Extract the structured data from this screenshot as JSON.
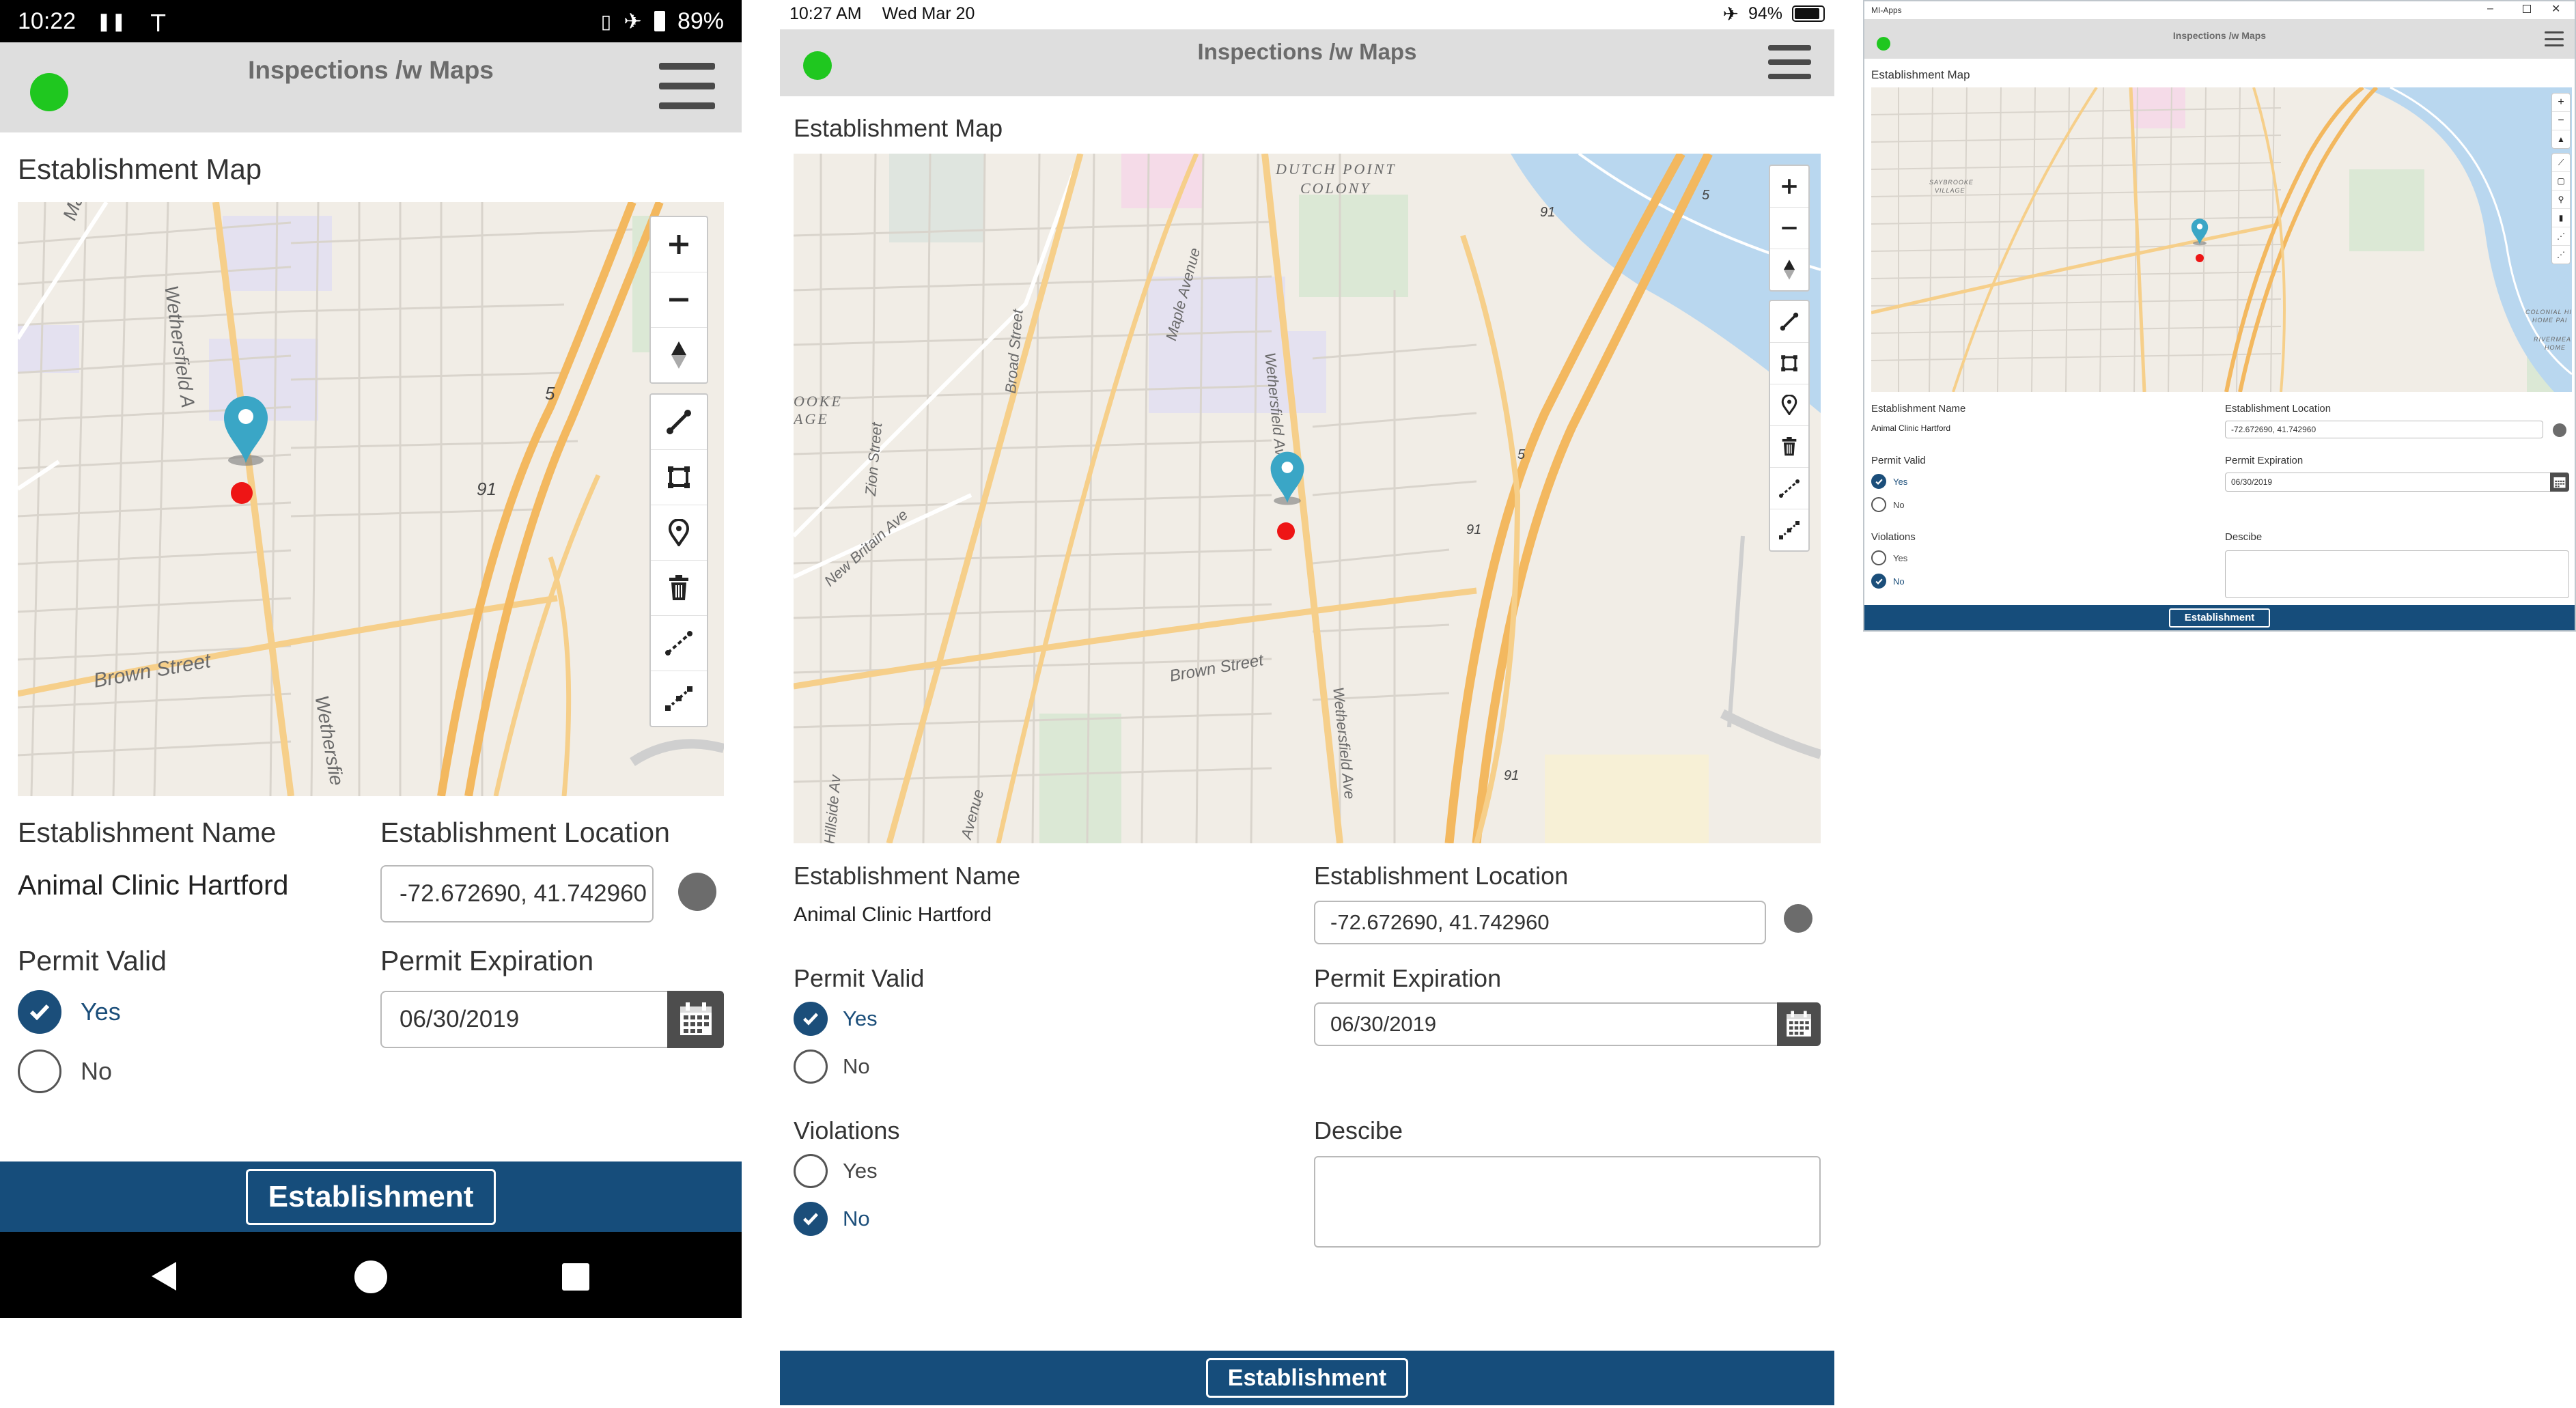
{
  "app": {
    "title": "Inspections /w Maps",
    "accent": "#164d7b",
    "status_dot_color": "#1fc71f"
  },
  "android": {
    "status": {
      "time": "10:22",
      "battery": "89%"
    },
    "section_title": "Establishment Map",
    "name_label": "Establishment Name",
    "name_value": "Animal Clinic Hartford",
    "location_label": "Establishment Location",
    "location_value": "-72.672690, 41.742960",
    "permit_label": "Permit Valid",
    "permit_yes": "Yes",
    "permit_no": "No",
    "permit_value": "Yes",
    "expiration_label": "Permit Expiration",
    "expiration_value": "06/30/2019",
    "footer_button": "Establishment",
    "map_labels": {
      "street1": "Brown Street",
      "street2": "Wethersfield A",
      "street3": "Wethersfie",
      "street4": "Maple",
      "route1": "91",
      "route2": "5"
    },
    "nav": [
      "back-icon",
      "home-icon",
      "recents-icon"
    ]
  },
  "ipad": {
    "status": {
      "time": "10:27 AM",
      "date": "Wed Mar 20",
      "battery": "94%"
    },
    "section_title": "Establishment Map",
    "name_label": "Establishment Name",
    "name_value": "Animal Clinic Hartford",
    "location_label": "Establishment Location",
    "location_value": "-72.672690, 41.742960",
    "permit_label": "Permit Valid",
    "permit_yes": "Yes",
    "permit_no": "No",
    "permit_value": "Yes",
    "expiration_label": "Permit Expiration",
    "expiration_value": "06/30/2019",
    "violations_label": "Violations",
    "violations_yes": "Yes",
    "violations_no": "No",
    "violations_value": "No",
    "describe_label": "Descibe",
    "footer_button": "Establishment",
    "map_labels": {
      "place1": "DUTCH POINT",
      "place2": "COLONY",
      "street1": "Brown Street",
      "street2": "Wethersfield Ave",
      "street3": "Maple Avenue",
      "street4": "Broad Street",
      "street5": "Zion Street",
      "street6": "New Britain Ave",
      "street7": "Avenue",
      "street8": "Hillside Av",
      "place3": "OOKE",
      "place4": "AGE",
      "route1": "91",
      "route2": "5"
    }
  },
  "windows": {
    "window_title": "MI-Apps",
    "section_title": "Establishment Map",
    "name_label": "Establishment Name",
    "name_value": "Animal Clinic Hartford",
    "location_label": "Establishment Location",
    "location_value": "-72.672690, 41.742960",
    "permit_label": "Permit Valid",
    "permit_yes": "Yes",
    "permit_no": "No",
    "permit_value": "Yes",
    "expiration_label": "Permit Expiration",
    "expiration_value": "06/30/2019",
    "violations_label": "Violations",
    "violations_yes": "Yes",
    "violations_no": "No",
    "violations_value": "No",
    "describe_label": "Descibe",
    "footer_button": "Establishment",
    "map_labels": {
      "place1": "SAYBROOKE",
      "place2": "VILLAGE",
      "place3": "COLONIAL HI",
      "place4": "HOME PAI",
      "place5": "RIVERMEA",
      "place6": "HOME"
    }
  }
}
